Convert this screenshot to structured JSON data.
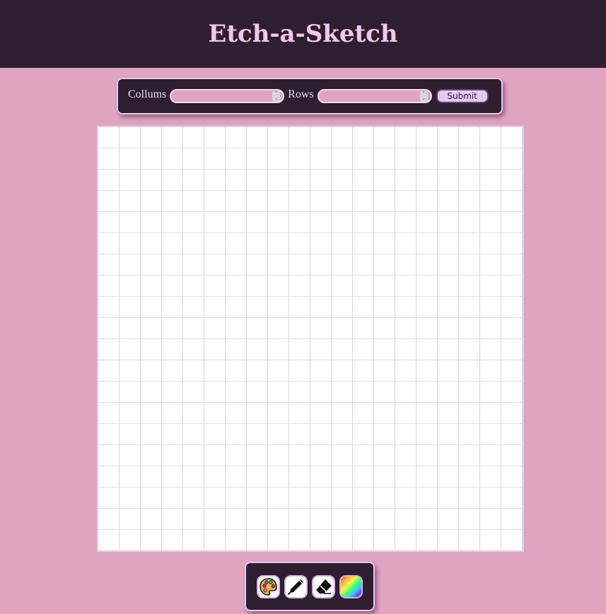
{
  "header": {
    "title": "Etch-a-Sketch"
  },
  "controls": {
    "columns_label": "Collums",
    "columns_value": "",
    "rows_label": "Rows",
    "rows_value": "",
    "submit_label": "Submit"
  },
  "grid": {
    "columns": 20,
    "rows": 20
  },
  "tools": [
    {
      "name": "palette-icon"
    },
    {
      "name": "pen-icon"
    },
    {
      "name": "eraser-icon"
    },
    {
      "name": "rainbow-icon"
    }
  ],
  "colors": {
    "background": "#e0a3c0",
    "panel": "#2d1f30",
    "title": "#f4c6ec",
    "accent_border": "#e8c9f0"
  }
}
